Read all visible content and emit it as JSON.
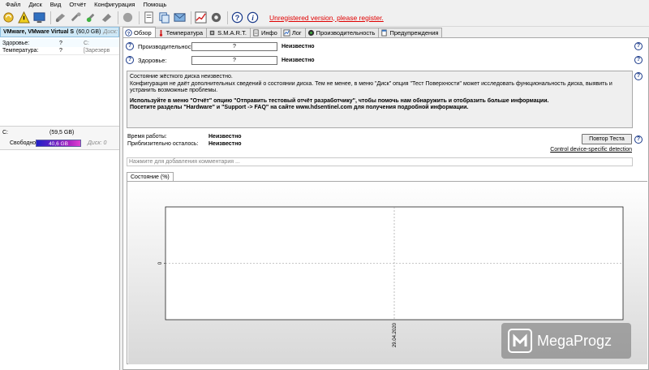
{
  "menu": [
    "Файл",
    "Диск",
    "Вид",
    "Отчёт",
    "Конфигурация",
    "Помощь"
  ],
  "toolbar": {
    "unregistered_text": "Unregistered version, please register."
  },
  "left_panel": {
    "disk_name": "VMware, VMware Virtual S",
    "disk_size": "(60,0 GB)",
    "disk_label": "Диск:",
    "health_label": "Здоровье:",
    "health_value": "?",
    "health_extra": "C:",
    "temp_label": "Температура:",
    "temp_value": "?",
    "temp_extra": "[Зарезерв",
    "partition_letter": "C:",
    "partition_size": "(59,5 GB)",
    "free_label": "Свободно",
    "free_value": "40,6 GB",
    "free_fraction": 0.68,
    "disk_index": "Диск: 0"
  },
  "tabs": [
    {
      "label": "Обзор",
      "icon": "help-icon",
      "active": true
    },
    {
      "label": "Температура",
      "icon": "thermometer-icon"
    },
    {
      "label": "S.M.A.R.T.",
      "icon": "chip-icon"
    },
    {
      "label": "Инфо",
      "icon": "document-icon"
    },
    {
      "label": "Лог",
      "icon": "log-icon"
    },
    {
      "label": "Производительность",
      "icon": "gauge-icon"
    },
    {
      "label": "Предупреждения",
      "icon": "alert-page-icon"
    }
  ],
  "overview": {
    "perf_label": "Производительность:",
    "perf_value": "?",
    "perf_status": "Неизвестно",
    "health_label": "Здоровье:",
    "health_value": "?",
    "health_status": "Неизвестно",
    "desc_line1": "Состояние жёсткого диска неизвестно.",
    "desc_line2": "Конфигурация не даёт дополнительных сведений о состоянии диска. Тем не менее, в меню \"Диск\" опция \"Тест Поверхности\" может исследовать функциональность диска, выявить и устранить возможные проблемы.",
    "desc_bold1": "Используйте в меню \"Отчёт\" опцию \"Отправить тестовый отчёт разработчику\", чтобы помочь нам обнаружить и отобразить больше информации.",
    "desc_bold2": "Посетите разделы \"Hardware\" и \"Support -> FAQ\" на сайте www.hdsentinel.com для получения подробной информации.",
    "uptime_label": "Время работы:",
    "uptime_value": "Неизвестно",
    "remaining_label": "Приблизительно осталось:",
    "remaining_value": "Неизвестно",
    "retest_label": "Повтор Теста",
    "control_link": "Control device-specific detection",
    "comment_placeholder": "Нажмите для добавления комментария ...",
    "state_tab": "Состояние (%)"
  },
  "chart_data": {
    "type": "line",
    "x": [
      "29.04.2020"
    ],
    "series": [],
    "y_ticks": [
      "0"
    ],
    "x_ticks": [
      "29.04.2020"
    ],
    "grid": true
  },
  "watermark": {
    "text": "MegaProgz"
  }
}
